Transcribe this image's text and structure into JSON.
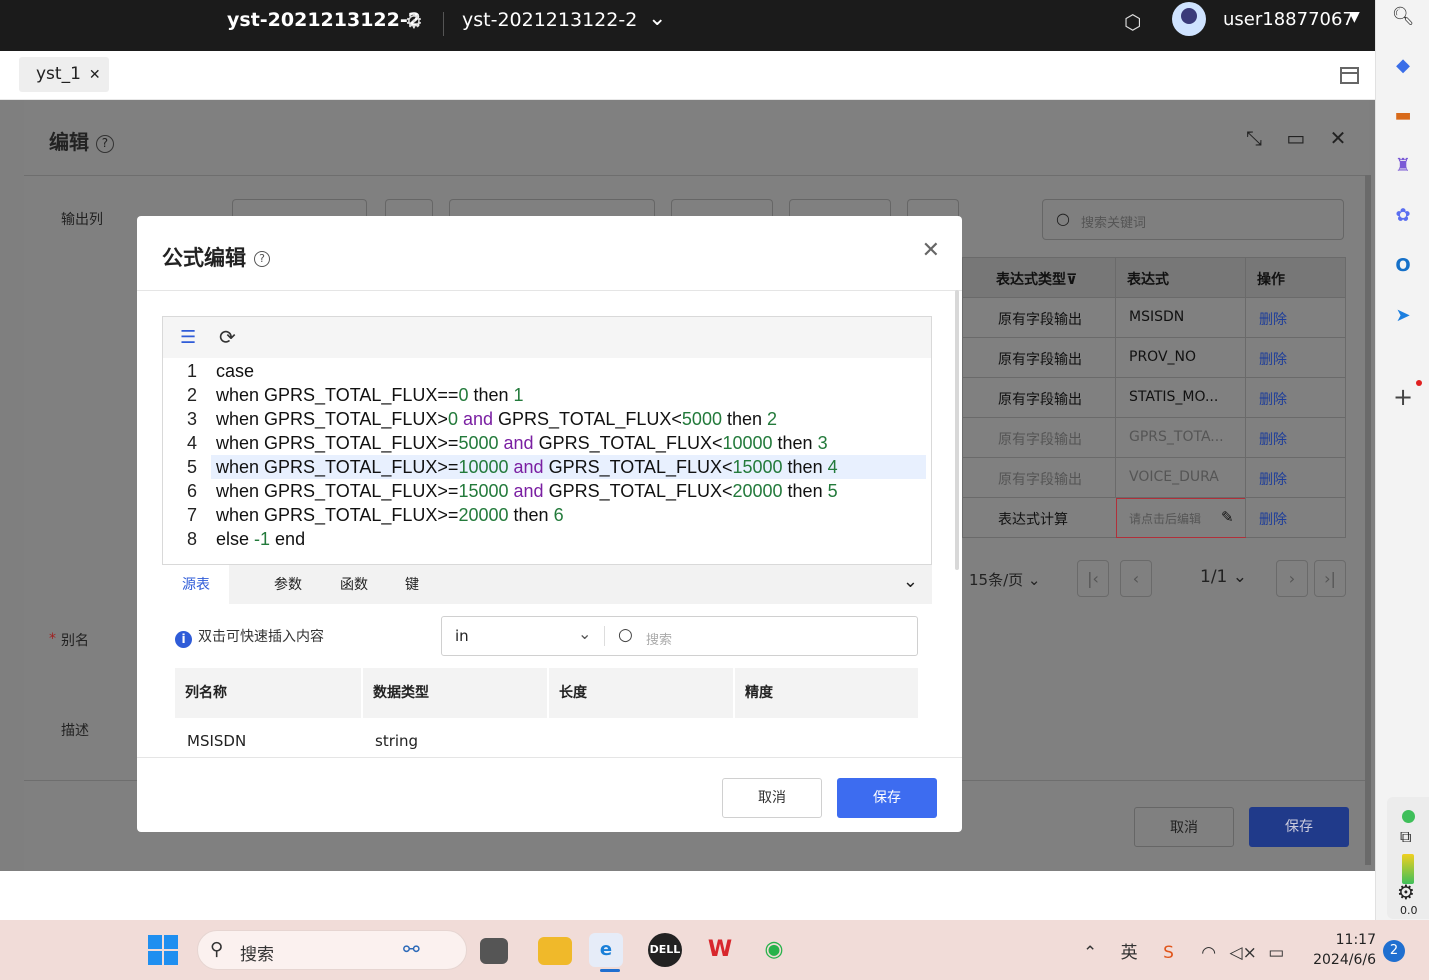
{
  "topbar": {
    "project": "yst-2021213122-2",
    "workspace": "yst-2021213122-2",
    "username": "user18877067"
  },
  "tabs": [
    {
      "label": "yst_1"
    }
  ],
  "outer_dialog": {
    "title": "编辑",
    "labels": {
      "output_columns": "输出列",
      "alias": "别名",
      "alias_required": "*",
      "description": "描述"
    },
    "search_placeholder": "搜索关键词",
    "table": {
      "headers": [
        "表达式类型",
        "表达式",
        "操作"
      ],
      "rows": [
        {
          "type": "原有字段输出",
          "expr": "MSISDN",
          "action": "删除"
        },
        {
          "type": "原有字段输出",
          "expr": "PROV_NO",
          "action": "删除"
        },
        {
          "type": "原有字段输出",
          "expr": "STATIS_MO...",
          "action": "删除"
        },
        {
          "type": "原有字段输出",
          "expr": "GPRS_TOTA...",
          "action": "删除"
        },
        {
          "type": "原有字段输出",
          "expr": "VOICE_DURA",
          "action": "删除"
        },
        {
          "type": "表达式计算",
          "expr": "请点击后编辑",
          "action": "删除"
        }
      ]
    },
    "pagination": {
      "page_size": "15条/页",
      "page": "1/1"
    },
    "cancel": "取消",
    "save": "保存"
  },
  "formula_dialog": {
    "title": "公式编辑",
    "code_lines": [
      [
        {
          "t": "case"
        }
      ],
      [
        {
          "t": "when GPRS_TOTAL_FLUX=="
        },
        {
          "t": "0",
          "c": "nm"
        },
        {
          "t": " then "
        },
        {
          "t": "1",
          "c": "nm"
        }
      ],
      [
        {
          "t": "when GPRS_TOTAL_FLUX>"
        },
        {
          "t": "0",
          "c": "nm"
        },
        {
          "t": " "
        },
        {
          "t": "and",
          "c": "kw"
        },
        {
          "t": " GPRS_TOTAL_FLUX<"
        },
        {
          "t": "5000",
          "c": "nm"
        },
        {
          "t": " then "
        },
        {
          "t": "2",
          "c": "nm"
        }
      ],
      [
        {
          "t": "when GPRS_TOTAL_FLUX>="
        },
        {
          "t": "5000",
          "c": "nm"
        },
        {
          "t": " "
        },
        {
          "t": "and",
          "c": "kw"
        },
        {
          "t": " GPRS_TOTAL_FLUX<"
        },
        {
          "t": "10000",
          "c": "nm"
        },
        {
          "t": " then "
        },
        {
          "t": "3",
          "c": "nm"
        }
      ],
      [
        {
          "t": "when GPRS_TOTAL_FLUX>="
        },
        {
          "t": "10000",
          "c": "nm"
        },
        {
          "t": " "
        },
        {
          "t": "and",
          "c": "kw"
        },
        {
          "t": " GPRS_TOTAL_FLUX<"
        },
        {
          "t": "15000",
          "c": "nm"
        },
        {
          "t": " then "
        },
        {
          "t": "4",
          "c": "nm"
        }
      ],
      [
        {
          "t": "when GPRS_TOTAL_FLUX>="
        },
        {
          "t": "15000",
          "c": "nm"
        },
        {
          "t": " "
        },
        {
          "t": "and",
          "c": "kw"
        },
        {
          "t": " GPRS_TOTAL_FLUX<"
        },
        {
          "t": "20000",
          "c": "nm"
        },
        {
          "t": " then "
        },
        {
          "t": "5",
          "c": "nm"
        }
      ],
      [
        {
          "t": "when GPRS_TOTAL_FLUX>="
        },
        {
          "t": "20000",
          "c": "nm"
        },
        {
          "t": " then "
        },
        {
          "t": "6",
          "c": "nm"
        }
      ],
      [
        {
          "t": "else "
        },
        {
          "t": "-1",
          "c": "nm"
        },
        {
          "t": " end"
        }
      ]
    ],
    "highlighted_line": 5,
    "tabs": [
      "源表",
      "参数",
      "函数",
      "键"
    ],
    "active_tab": 0,
    "hint": "双击可快速插入内容",
    "source_select": "in",
    "search_placeholder": "搜索",
    "columns_table": {
      "headers": [
        "列名称",
        "数据类型",
        "长度",
        "精度"
      ],
      "rows": [
        [
          "MSISDN",
          "string",
          "",
          ""
        ]
      ]
    },
    "cancel": "取消",
    "save": "保存"
  },
  "taskbar": {
    "search_label": "搜索",
    "ime": "英",
    "time": "11:17",
    "date": "2024/6/6",
    "notifications": "2"
  },
  "widget": {
    "value": "0.0"
  },
  "colors": {
    "primary": "#3d6cf0",
    "keyword": "#7a1fa2",
    "number": "#237a3b",
    "line_highlight": "#e8f0fe"
  }
}
